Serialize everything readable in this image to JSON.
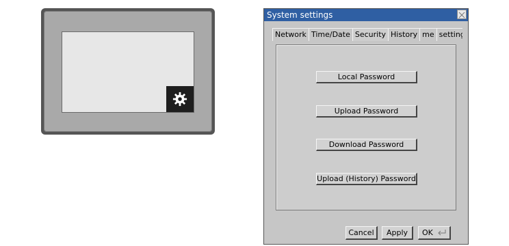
{
  "dialog": {
    "title": "System settings",
    "tabs": [
      {
        "label": "Network",
        "active": false
      },
      {
        "label": "Time/Date",
        "active": false
      },
      {
        "label": "Security",
        "active": true
      },
      {
        "label": "History",
        "active": false
      },
      {
        "label": "me",
        "active": false
      },
      {
        "label": "setting",
        "active": false
      },
      {
        "label": "g",
        "active": false
      }
    ],
    "security_buttons": [
      {
        "label": "Local Password"
      },
      {
        "label": "Upload Password"
      },
      {
        "label": "Download Password"
      },
      {
        "label": "Upload (History) Password"
      }
    ],
    "footer": {
      "cancel_label": "Cancel",
      "apply_label": "Apply",
      "ok_label": "OK"
    }
  },
  "device": {
    "settings_icon": "gear-icon"
  },
  "colors": {
    "titlebar": "#2f5fa3",
    "dialog_bg": "#c6c6c6",
    "device_frame": "#555555",
    "gear_button": "#1e1e1e"
  }
}
